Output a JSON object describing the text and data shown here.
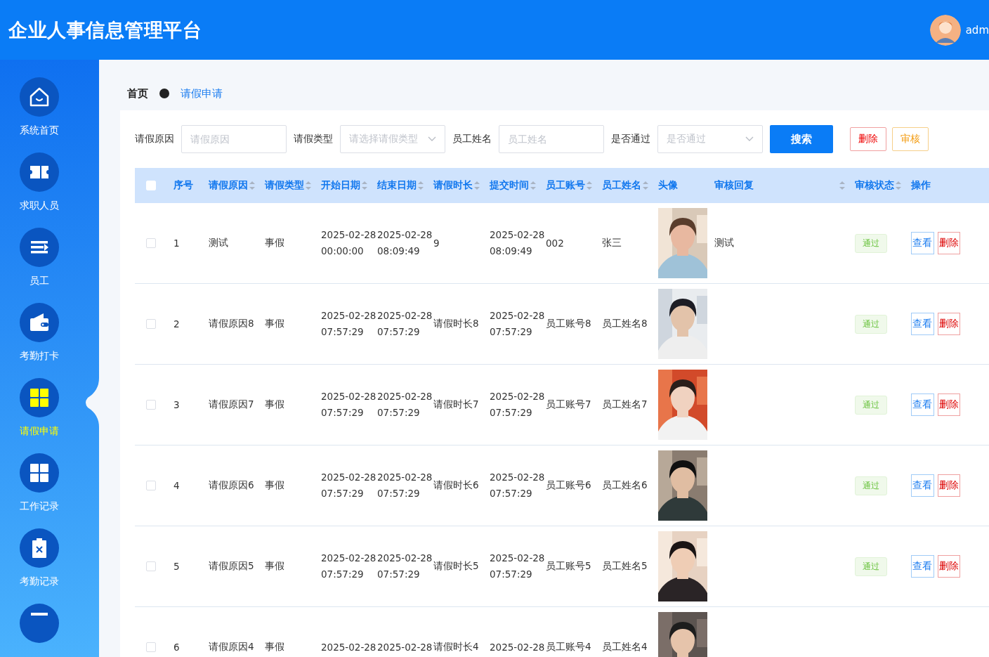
{
  "header": {
    "title": "企业人事信息管理平台",
    "user": "adm"
  },
  "sidebar": {
    "items": [
      {
        "label": "系统首页",
        "selected": false
      },
      {
        "label": "求职人员",
        "selected": false
      },
      {
        "label": "员工",
        "selected": false
      },
      {
        "label": "考勤打卡",
        "selected": false
      },
      {
        "label": "请假申请",
        "selected": true
      },
      {
        "label": "工作记录",
        "selected": false
      },
      {
        "label": "考勤记录",
        "selected": false
      },
      {
        "selected": false
      }
    ]
  },
  "breadcrumb": {
    "home": "首页",
    "current": "请假申请"
  },
  "filters": [
    {
      "kind": "input",
      "label": "请假原因",
      "placeholder": "请假原因"
    },
    {
      "kind": "select",
      "label": "请假类型",
      "placeholder": "请选择请假类型"
    },
    {
      "kind": "input",
      "label": "员工姓名",
      "placeholder": "员工姓名"
    },
    {
      "kind": "select",
      "label": "是否通过",
      "placeholder": "是否通过"
    }
  ],
  "buttons": [
    {
      "kind": "primary",
      "label": "搜索"
    },
    {
      "kind": "danger",
      "label": "删除"
    },
    {
      "kind": "warning",
      "label": "审核"
    }
  ],
  "table": {
    "select_all": {
      "checked": false
    },
    "columns": [
      {
        "label": "序号",
        "sortable": false
      },
      {
        "label": "请假原因",
        "sortable": true
      },
      {
        "label": "请假类型",
        "sortable": true
      },
      {
        "label": "开始日期",
        "sortable": true
      },
      {
        "label": "结束日期",
        "sortable": true
      },
      {
        "label": "请假时长",
        "sortable": true
      },
      {
        "label": "提交时间",
        "sortable": true
      },
      {
        "label": "员工账号",
        "sortable": true
      },
      {
        "label": "员工姓名",
        "sortable": true
      },
      {
        "label": "头像",
        "sortable": false
      },
      {
        "label": "审核回复",
        "sortable": true
      },
      {
        "label": "审核状态",
        "sortable": true
      },
      {
        "label": "操作",
        "sortable": false
      }
    ],
    "rows": [
      {
        "checked": false,
        "no": "1",
        "reason": "测试",
        "type": "事假",
        "start": {
          "date": "2025-02-28",
          "time": "00:00:00"
        },
        "end": {
          "date": "2025-02-28",
          "time": "08:09:49"
        },
        "duration": "9",
        "submitted": {
          "date": "2025-02-28",
          "time": "08:09:49"
        },
        "account": "002",
        "name": "张三",
        "avatar": {
          "kind": "picture"
        },
        "reply": "测试",
        "status": "通过",
        "actions": [
          "查看",
          "删除"
        ]
      },
      {
        "checked": false,
        "no": "2",
        "reason": "请假原因8",
        "type": "事假",
        "start": {
          "date": "2025-02-28",
          "time": "07:57:29"
        },
        "end": {
          "date": "2025-02-28",
          "time": "07:57:29"
        },
        "duration": "请假时长8",
        "submitted": {
          "date": "2025-02-28",
          "time": "07:57:29"
        },
        "account": "员工账号8",
        "name": "员工姓名8",
        "avatar": {
          "kind": "picture"
        },
        "status": "通过",
        "actions": [
          "查看",
          "删除"
        ]
      },
      {
        "checked": false,
        "no": "3",
        "reason": "请假原因7",
        "type": "事假",
        "start": {
          "date": "2025-02-28",
          "time": "07:57:29"
        },
        "end": {
          "date": "2025-02-28",
          "time": "07:57:29"
        },
        "duration": "请假时长7",
        "submitted": {
          "date": "2025-02-28",
          "time": "07:57:29"
        },
        "account": "员工账号7",
        "name": "员工姓名7",
        "avatar": {
          "kind": "picture"
        },
        "status": "通过",
        "actions": [
          "查看",
          "删除"
        ]
      },
      {
        "checked": false,
        "no": "4",
        "reason": "请假原因6",
        "type": "事假",
        "start": {
          "date": "2025-02-28",
          "time": "07:57:29"
        },
        "end": {
          "date": "2025-02-28",
          "time": "07:57:29"
        },
        "duration": "请假时长6",
        "submitted": {
          "date": "2025-02-28",
          "time": "07:57:29"
        },
        "account": "员工账号6",
        "name": "员工姓名6",
        "avatar": {
          "kind": "picture"
        },
        "status": "通过",
        "actions": [
          "查看",
          "删除"
        ]
      },
      {
        "checked": false,
        "no": "5",
        "reason": "请假原因5",
        "type": "事假",
        "start": {
          "date": "2025-02-28",
          "time": "07:57:29"
        },
        "end": {
          "date": "2025-02-28",
          "time": "07:57:29"
        },
        "duration": "请假时长5",
        "submitted": {
          "date": "2025-02-28",
          "time": "07:57:29"
        },
        "account": "员工账号5",
        "name": "员工姓名5",
        "avatar": {
          "kind": "picture"
        },
        "status": "通过",
        "actions": [
          "查看",
          "删除"
        ]
      },
      {
        "checked": false,
        "no": "6",
        "reason": "请假原因4",
        "type": "事假",
        "start": {
          "date": "2025-02-28"
        },
        "end": {
          "date": "2025-02-28"
        },
        "duration": "请假时长4",
        "submitted": {
          "date": "2025-02-28"
        },
        "account": "员工账号4",
        "name": "员工姓名4",
        "avatar": {
          "kind": "picture"
        }
      }
    ]
  }
}
